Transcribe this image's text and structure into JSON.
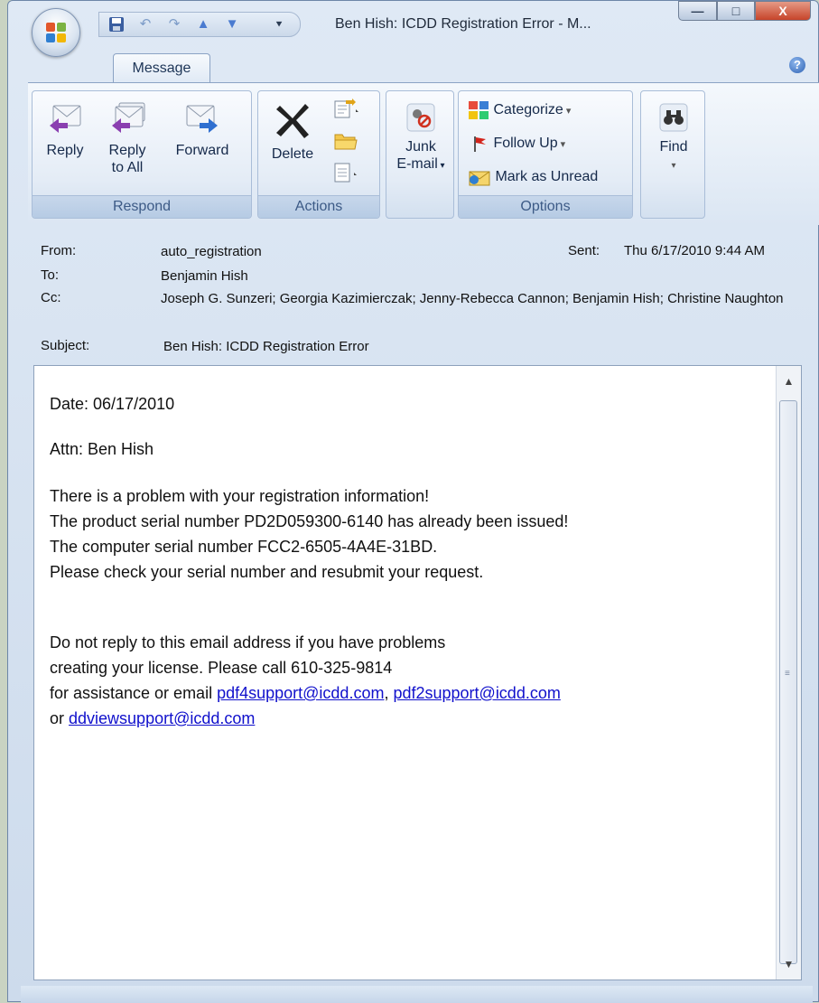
{
  "window": {
    "title": "Ben Hish: ICDD Registration Error - M...",
    "controls": {
      "minimize": "—",
      "maximize": "□",
      "close": "X"
    }
  },
  "tabs": [
    {
      "label": "Message",
      "active": true
    }
  ],
  "help_glyph": "?",
  "ribbon": {
    "respond": {
      "label": "Respond",
      "reply": "Reply",
      "reply_all_line1": "Reply",
      "reply_all_line2": "to All",
      "forward": "Forward"
    },
    "actions": {
      "label": "Actions",
      "delete": "Delete"
    },
    "junk": {
      "line1": "Junk",
      "line2": "E-mail"
    },
    "options": {
      "label": "Options",
      "categorize": "Categorize",
      "follow_up": "Follow Up",
      "mark_unread": "Mark as Unread"
    },
    "find": {
      "label": "Find"
    }
  },
  "header": {
    "from_label": "From:",
    "from": "auto_registration",
    "sent_label": "Sent:",
    "sent": "Thu 6/17/2010 9:44 AM",
    "to_label": "To:",
    "to": "Benjamin Hish",
    "cc_label": "Cc:",
    "cc": "Joseph G. Sunzeri; Georgia Kazimierczak; Jenny-Rebecca Cannon; Benjamin Hish; Christine Naughton",
    "subject_label": "Subject:",
    "subject": "Ben Hish:  ICDD Registration Error"
  },
  "body": {
    "date": "Date: 06/17/2010",
    "attn": "Attn: Ben Hish",
    "line1": "There is a problem with your registration information!",
    "line2": "The product serial number PD2D059300-6140 has already been issued!",
    "line3": "The computer serial number FCC2-6505-4A4E-31BD.",
    "line4": "Please check your serial number and resubmit your request.",
    "line5": "Do not reply to this email address if you have problems",
    "line6": "creating your license.  Please call 610-325-9814",
    "line7_prefix": "for assistance or email ",
    "link1": "pdf4support@icdd.com",
    "sep": ", ",
    "link2": "pdf2support@icdd.com",
    "line8_prefix": "or ",
    "link3": "ddviewsupport@icdd.com"
  },
  "icons": {
    "office_button": "office-logo-icon",
    "save": "save-icon",
    "undo": "undo-icon",
    "redo": "redo-icon",
    "previous": "up-arrow-icon",
    "next": "down-arrow-icon"
  },
  "colors": {
    "accent": "#3c5a86",
    "link": "#1010cc",
    "close_button": "#c7442a"
  }
}
